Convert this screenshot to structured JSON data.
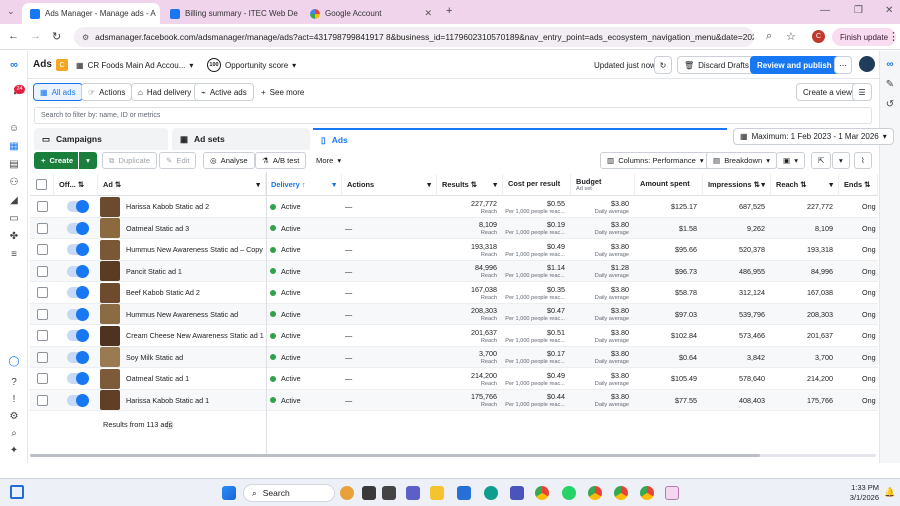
{
  "browser": {
    "tabs": [
      {
        "title": "Ads Manager - Manage ads - A",
        "active": true,
        "color": "#1877f2"
      },
      {
        "title": "Billing summary - ITEC Web De",
        "active": false,
        "color": "#1877f2"
      },
      {
        "title": "Google Account",
        "active": false,
        "color": "#ea4335"
      }
    ],
    "url": "adsmanager.facebook.com/adsmanager/manage/ads?act=431798799841917 8&business_id=1179602310570189&nav_entry_point=ads_ecosystem_navigation_menu&date=2026-01-...",
    "profile_initial": "C",
    "finish_update": "Finish update"
  },
  "header": {
    "title": "Ads",
    "account_badge": "C",
    "account_name": "CR Foods Main Ad Accou...",
    "opportunity_score_value": "100",
    "opportunity_score_label": "Opportunity score",
    "updated": "Updated just now",
    "discard": "Discard Drafts",
    "review": "Review and publish (9)"
  },
  "rail": {
    "notif_count": "24"
  },
  "toolbar": {
    "all_ads": "All ads",
    "actions": "Actions",
    "had_delivery": "Had delivery",
    "active_ads": "Active ads",
    "see_more": "See more",
    "create_view": "Create a view"
  },
  "filter": {
    "placeholder": "Search to filter by: name, ID or metrics"
  },
  "levels": {
    "campaigns": "Campaigns",
    "adsets": "Ad sets",
    "ads": "Ads",
    "date_range": "Maximum: 1 Feb 2023 - 1 Mar 2026"
  },
  "actionbar": {
    "create": "Create",
    "duplicate": "Duplicate",
    "edit": "Edit",
    "analyse": "Analyse",
    "abtest": "A/B test",
    "more": "More",
    "columns": "Columns: Performance",
    "breakdown": "Breakdown"
  },
  "columns": {
    "off_on": "Off...",
    "ad": "Ad",
    "delivery": "Delivery",
    "actions": "Actions",
    "results": "Results",
    "cost_per_result": "Cost per result",
    "budget": "Budget",
    "budget_sub": "Ad set",
    "amount_spent": "Amount spent",
    "impressions": "Impressions",
    "reach": "Reach",
    "ends": "Ends"
  },
  "rows": [
    {
      "name": "Harissa Kabob Static ad 2",
      "delivery": "Active",
      "actions": "—",
      "results": "227,772",
      "results_sub": "Reach",
      "cpr": "$0.55",
      "cpr_sub": "Per 1,000 people reac...",
      "budget": "$3.80",
      "budget_sub": "Daily average",
      "spent": "$125.17",
      "impressions": "687,525",
      "reach": "227,772",
      "ends": "Ong",
      "thumb": "#6b4a2e"
    },
    {
      "name": "Oatmeal Static ad 3",
      "delivery": "Active",
      "actions": "—",
      "results": "8,109",
      "results_sub": "Reach",
      "cpr": "$0.19",
      "cpr_sub": "Per 1,000 people reac...",
      "budget": "$3.80",
      "budget_sub": "Daily average",
      "spent": "$1.58",
      "impressions": "9,262",
      "reach": "8,109",
      "ends": "Ong",
      "thumb": "#8a6a3e"
    },
    {
      "name": "Hummus New Awareness Static ad – Copy",
      "delivery": "Active",
      "actions": "—",
      "results": "193,318",
      "results_sub": "Reach",
      "cpr": "$0.49",
      "cpr_sub": "Per 1,000 people reac...",
      "budget": "$3.80",
      "budget_sub": "Daily average",
      "spent": "$95.66",
      "impressions": "520,378",
      "reach": "193,318",
      "ends": "Ong",
      "thumb": "#7a5836"
    },
    {
      "name": "Pancit Static ad 1",
      "delivery": "Active",
      "actions": "—",
      "results": "84,996",
      "results_sub": "Reach",
      "cpr": "$1.14",
      "cpr_sub": "Per 1,000 people reac...",
      "budget": "$1.28",
      "budget_sub": "Daily average",
      "spent": "$96.73",
      "impressions": "486,955",
      "reach": "84,996",
      "ends": "Ong",
      "thumb": "#5a3c22"
    },
    {
      "name": "Beef Kabob Static Ad 2",
      "delivery": "Active",
      "actions": "—",
      "results": "167,038",
      "results_sub": "Reach",
      "cpr": "$0.35",
      "cpr_sub": "Per 1,000 people reac...",
      "budget": "$3.80",
      "budget_sub": "Daily average",
      "spent": "$58.78",
      "impressions": "312,124",
      "reach": "167,038",
      "ends": "Ong",
      "thumb": "#6e4b2c"
    },
    {
      "name": "Hummus New Awareness Static ad",
      "delivery": "Active",
      "actions": "—",
      "results": "208,303",
      "results_sub": "Reach",
      "cpr": "$0.47",
      "cpr_sub": "Per 1,000 people reac...",
      "budget": "$3.80",
      "budget_sub": "Daily average",
      "spent": "$97.03",
      "impressions": "539,796",
      "reach": "208,303",
      "ends": "Ong",
      "thumb": "#8b6b44"
    },
    {
      "name": "Cream Cheese New Awareness Static ad 1",
      "delivery": "Active",
      "actions": "—",
      "results": "201,637",
      "results_sub": "Reach",
      "cpr": "$0.51",
      "cpr_sub": "Per 1,000 people reac...",
      "budget": "$3.80",
      "budget_sub": "Daily average",
      "spent": "$102.84",
      "impressions": "573,466",
      "reach": "201,637",
      "ends": "Ong",
      "thumb": "#4f3320"
    },
    {
      "name": "Soy Milk Static ad",
      "delivery": "Active",
      "actions": "—",
      "results": "3,700",
      "results_sub": "Reach",
      "cpr": "$0.17",
      "cpr_sub": "Per 1,000 people reac...",
      "budget": "$3.80",
      "budget_sub": "Daily average",
      "spent": "$0.64",
      "impressions": "3,842",
      "reach": "3,700",
      "ends": "Ong",
      "thumb": "#9a7a52"
    },
    {
      "name": "Oatmeal Static ad 1",
      "delivery": "Active",
      "actions": "—",
      "results": "214,200",
      "results_sub": "Reach",
      "cpr": "$0.49",
      "cpr_sub": "Per 1,000 people reac...",
      "budget": "$3.80",
      "budget_sub": "Daily average",
      "spent": "$105.49",
      "impressions": "578,640",
      "reach": "214,200",
      "ends": "Ong",
      "thumb": "#7d5b3a"
    },
    {
      "name": "Harissa Kabob Static ad 1",
      "delivery": "Active",
      "actions": "—",
      "results": "175,766",
      "results_sub": "Reach",
      "cpr": "$0.44",
      "cpr_sub": "Per 1,000 people reac...",
      "budget": "$3.80",
      "budget_sub": "Daily average",
      "spent": "$77.55",
      "impressions": "408,403",
      "reach": "175,766",
      "ends": "Ong",
      "thumb": "#603f25"
    }
  ],
  "footer": {
    "results_total": "Results from 113 ads"
  },
  "taskbar": {
    "search": "Search",
    "time": "1:33 PM",
    "date": "3/1/2026"
  }
}
